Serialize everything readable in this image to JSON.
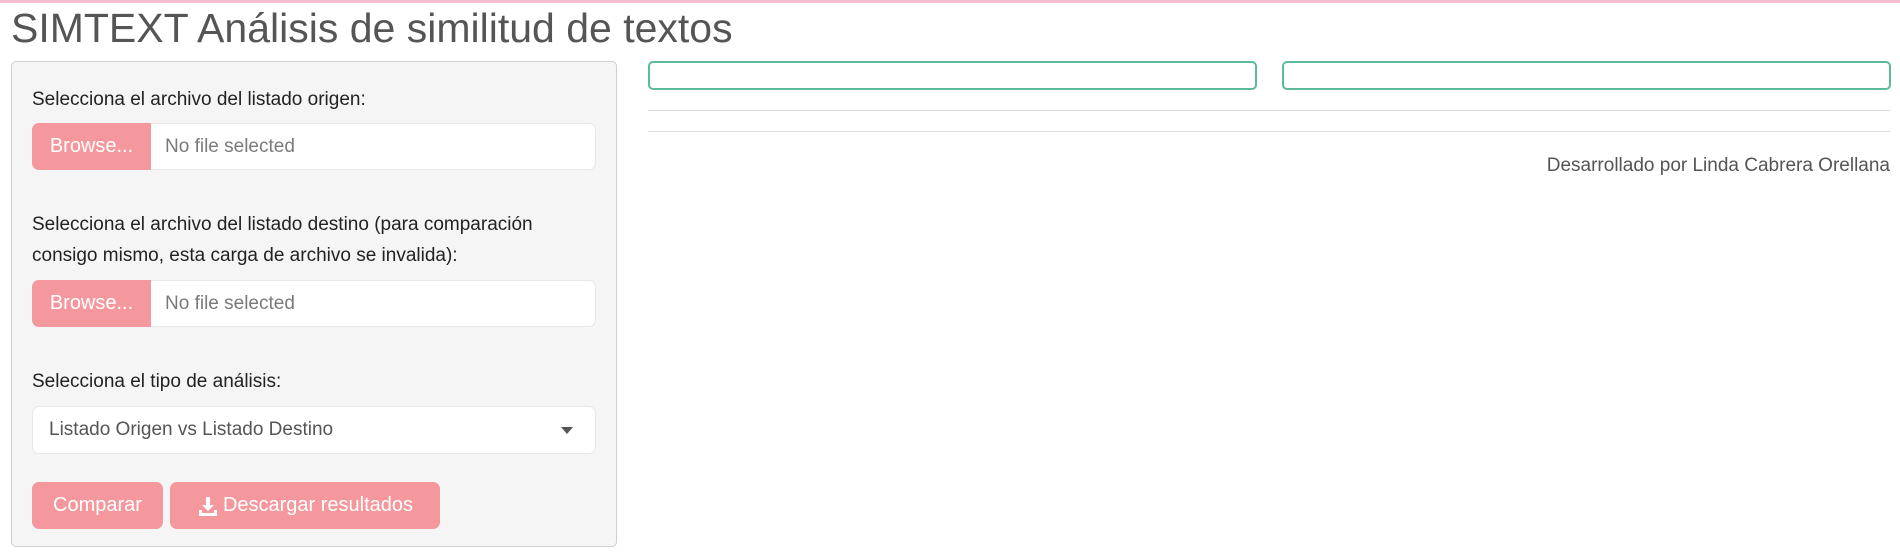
{
  "app": {
    "title": "SIMTEXT Análisis de similitud de textos"
  },
  "sidebar": {
    "origin_file": {
      "label": "Selecciona el archivo del listado origen:",
      "browse_label": "Browse...",
      "status": "No file selected"
    },
    "target_file": {
      "label": "Selecciona el archivo del listado destino (para comparación consigo mismo, esta carga de archivo se invalida):",
      "browse_label": "Browse...",
      "status": "No file selected"
    },
    "analysis_type": {
      "label": "Selecciona el tipo de análisis:",
      "selected": "Listado Origen vs Listado Destino"
    },
    "buttons": {
      "compare": "Comparar",
      "download": "Descargar resultados"
    }
  },
  "main": {
    "credit": "Desarrollado por Linda Cabrera Orellana"
  },
  "colors": {
    "accent_button": "#f4989d",
    "output_border": "#5dbb9a",
    "top_accent": "#f7bcd2"
  },
  "icons": {
    "download": "download-icon",
    "select_caret": "caret-down-icon"
  }
}
